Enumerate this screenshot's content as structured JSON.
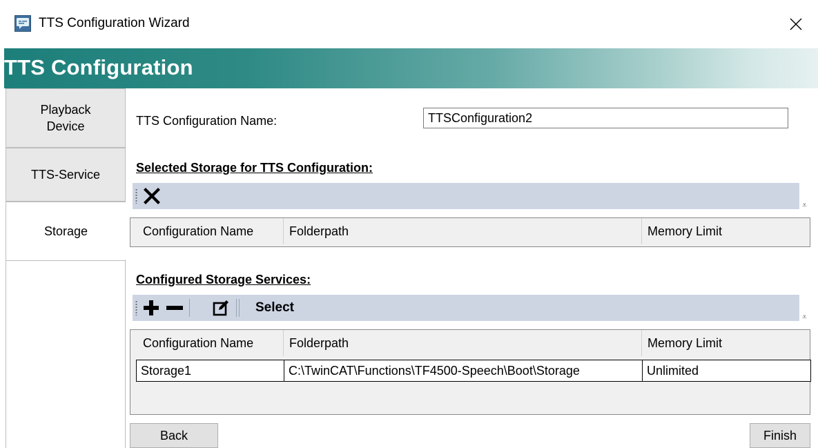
{
  "window": {
    "title": "TTS Configuration Wizard",
    "icon": "speech-bubble-icon",
    "close_icon": "close-icon"
  },
  "banner": {
    "title": "TTS Configuration",
    "gradient_from": "#1d7f7a",
    "gradient_to": "#e6f1f0"
  },
  "nav": {
    "tabs": [
      {
        "label": "Playback\nDevice",
        "active": false
      },
      {
        "label": "TTS-Service",
        "active": false
      },
      {
        "label": "Storage",
        "active": true
      }
    ]
  },
  "form": {
    "name_label": "TTS Configuration Name:",
    "name_value": "TTSConfiguration2"
  },
  "selected_storage": {
    "heading": "Selected Storage for TTS Configuration:",
    "toolbar": {
      "remove_icon": "x-remove-icon"
    },
    "columns": [
      "Configuration Name",
      "Folderpath",
      "Memory Limit"
    ],
    "rows": []
  },
  "configured_storage": {
    "heading": "Configured Storage Services:",
    "toolbar": {
      "add_icon": "plus-icon",
      "remove_icon": "minus-icon",
      "edit_icon": "edit-icon",
      "select_label": "Select"
    },
    "columns": [
      "Configuration Name",
      "Folderpath",
      "Memory Limit"
    ],
    "rows": [
      [
        "Storage1",
        "C:\\TwinCAT\\Functions\\TF4500-Speech\\Boot\\Storage",
        "Unlimited"
      ]
    ]
  },
  "buttons": {
    "back": "Back",
    "finish": "Finish"
  },
  "colors": {
    "toolbar_bg": "#cdd5e3",
    "accent": "#1d7f7a"
  }
}
